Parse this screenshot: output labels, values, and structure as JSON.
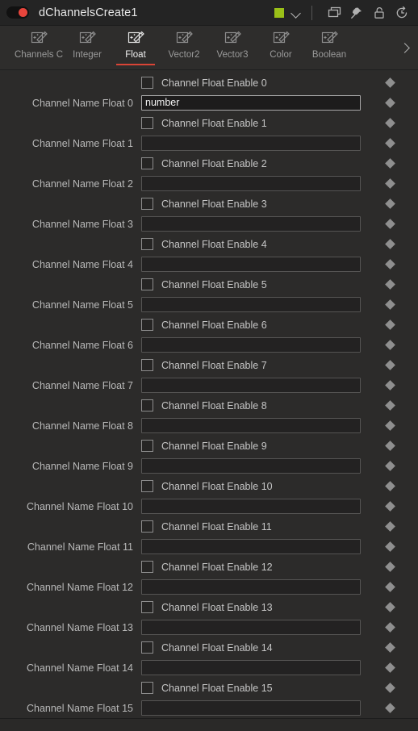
{
  "titlebar": {
    "node_name": "dChannelsCreate1",
    "enable_toggle": {
      "name": "node-enable-toggle",
      "state": "on",
      "knob_color": "#e8453c"
    },
    "color_swatch": "#9ac018",
    "icons": [
      "chevron-down-icon",
      "duplicate-icon",
      "pin-icon",
      "lock-icon",
      "reset-icon"
    ]
  },
  "tabbar": {
    "tabs": [
      {
        "label": "Channels C",
        "active": false
      },
      {
        "label": "Integer",
        "active": false
      },
      {
        "label": "Float",
        "active": true
      },
      {
        "label": "Vector2",
        "active": false
      },
      {
        "label": "Vector3",
        "active": false
      },
      {
        "label": "Color",
        "active": false
      },
      {
        "label": "Boolean",
        "active": false
      }
    ],
    "active_tab": "Float",
    "active_underline_color": "#d94436",
    "scroll_right_label": ">"
  },
  "properties": {
    "rows": [
      {
        "type": "checkbox",
        "label": "",
        "checkbox_label": "Channel Float Enable 0",
        "checked": false,
        "keyframe": true
      },
      {
        "type": "text",
        "label": "Channel Name Float 0",
        "value": "number",
        "active": true,
        "keyframe": true
      },
      {
        "type": "checkbox",
        "label": "",
        "checkbox_label": "Channel Float Enable 1",
        "checked": false,
        "keyframe": true
      },
      {
        "type": "text",
        "label": "Channel Name Float 1",
        "value": "",
        "active": false,
        "keyframe": true
      },
      {
        "type": "checkbox",
        "label": "",
        "checkbox_label": "Channel Float Enable 2",
        "checked": false,
        "keyframe": true
      },
      {
        "type": "text",
        "label": "Channel Name Float 2",
        "value": "",
        "active": false,
        "keyframe": true
      },
      {
        "type": "checkbox",
        "label": "",
        "checkbox_label": "Channel Float Enable 3",
        "checked": false,
        "keyframe": true
      },
      {
        "type": "text",
        "label": "Channel Name Float 3",
        "value": "",
        "active": false,
        "keyframe": true
      },
      {
        "type": "checkbox",
        "label": "",
        "checkbox_label": "Channel Float Enable 4",
        "checked": false,
        "keyframe": true
      },
      {
        "type": "text",
        "label": "Channel Name Float 4",
        "value": "",
        "active": false,
        "keyframe": true
      },
      {
        "type": "checkbox",
        "label": "",
        "checkbox_label": "Channel Float Enable 5",
        "checked": false,
        "keyframe": true
      },
      {
        "type": "text",
        "label": "Channel Name Float 5",
        "value": "",
        "active": false,
        "keyframe": true
      },
      {
        "type": "checkbox",
        "label": "",
        "checkbox_label": "Channel Float Enable 6",
        "checked": false,
        "keyframe": true
      },
      {
        "type": "text",
        "label": "Channel Name Float 6",
        "value": "",
        "active": false,
        "keyframe": true
      },
      {
        "type": "checkbox",
        "label": "",
        "checkbox_label": "Channel Float Enable 7",
        "checked": false,
        "keyframe": true
      },
      {
        "type": "text",
        "label": "Channel Name Float 7",
        "value": "",
        "active": false,
        "keyframe": true
      },
      {
        "type": "checkbox",
        "label": "",
        "checkbox_label": "Channel Float Enable 8",
        "checked": false,
        "keyframe": true
      },
      {
        "type": "text",
        "label": "Channel Name Float 8",
        "value": "",
        "active": false,
        "keyframe": true
      },
      {
        "type": "checkbox",
        "label": "",
        "checkbox_label": "Channel Float Enable 9",
        "checked": false,
        "keyframe": true
      },
      {
        "type": "text",
        "label": "Channel Name Float 9",
        "value": "",
        "active": false,
        "keyframe": true
      },
      {
        "type": "checkbox",
        "label": "",
        "checkbox_label": "Channel Float Enable 10",
        "checked": false,
        "keyframe": true
      },
      {
        "type": "text",
        "label": "Channel Name Float 10",
        "value": "",
        "active": false,
        "keyframe": true
      },
      {
        "type": "checkbox",
        "label": "",
        "checkbox_label": "Channel Float Enable 11",
        "checked": false,
        "keyframe": true
      },
      {
        "type": "text",
        "label": "Channel Name Float 11",
        "value": "",
        "active": false,
        "keyframe": true
      },
      {
        "type": "checkbox",
        "label": "",
        "checkbox_label": "Channel Float Enable 12",
        "checked": false,
        "keyframe": true
      },
      {
        "type": "text",
        "label": "Channel Name Float 12",
        "value": "",
        "active": false,
        "keyframe": true
      },
      {
        "type": "checkbox",
        "label": "",
        "checkbox_label": "Channel Float Enable 13",
        "checked": false,
        "keyframe": true
      },
      {
        "type": "text",
        "label": "Channel Name Float 13",
        "value": "",
        "active": false,
        "keyframe": true
      },
      {
        "type": "checkbox",
        "label": "",
        "checkbox_label": "Channel Float Enable 14",
        "checked": false,
        "keyframe": true
      },
      {
        "type": "text",
        "label": "Channel Name Float 14",
        "value": "",
        "active": false,
        "keyframe": true
      },
      {
        "type": "checkbox",
        "label": "",
        "checkbox_label": "Channel Float Enable 15",
        "checked": false,
        "keyframe": true
      },
      {
        "type": "text",
        "label": "Channel Name Float 15",
        "value": "",
        "active": false,
        "keyframe": true
      }
    ]
  }
}
